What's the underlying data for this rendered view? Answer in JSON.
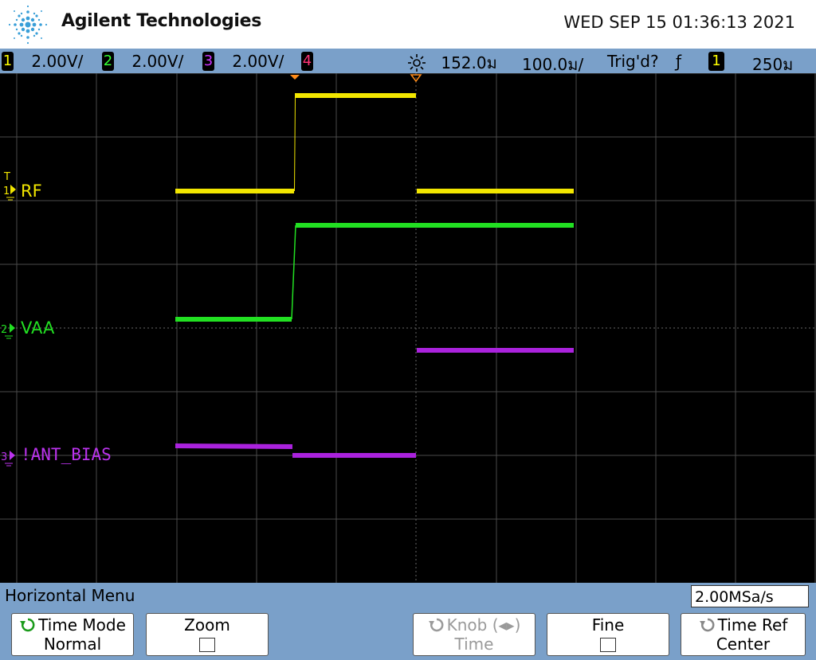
{
  "header": {
    "brand": "Agilent Technologies",
    "datetime": "WED SEP 15 01:36:13 2021"
  },
  "statusbar": {
    "ch1": {
      "num": "1",
      "scale": "2.00V/",
      "color": "#ffff00"
    },
    "ch2": {
      "num": "2",
      "scale": "2.00V/",
      "color": "#33ff33"
    },
    "ch3": {
      "num": "3",
      "scale": "2.00V/",
      "color": "#cc33ff"
    },
    "ch4": {
      "num": "4",
      "color": "#ff3377"
    },
    "delay": "152.0ม",
    "timebase": "100.0ม/",
    "trig_status": "Trig'd?",
    "trig_slope": "ƒ",
    "trig_source": "1",
    "trig_level": "250ม"
  },
  "channels": {
    "ch1_marker": "1",
    "ch1_label": "RF",
    "ch2_marker": "2",
    "ch2_label": "VAA",
    "ch3_marker": "3",
    "ch3_label": "!ANT_BIAS",
    "trig_marker": "T"
  },
  "menu": {
    "title": "Horizontal Menu",
    "sample_rate": "2.00MSa/s",
    "softkeys": [
      {
        "line1": "Time Mode",
        "line2": "Normal"
      },
      {
        "line1": "Zoom"
      },
      {
        "line1": "Knob (◂▸)",
        "line2": "Time"
      },
      {
        "line1": "Fine"
      },
      {
        "line1": "Time Ref",
        "line2": "Center"
      }
    ]
  },
  "colors": {
    "ch1": "#ffff00",
    "ch2": "#33ff33",
    "ch3": "#bb22ee",
    "grid": "#555555",
    "panel": "#7aa0c9"
  }
}
